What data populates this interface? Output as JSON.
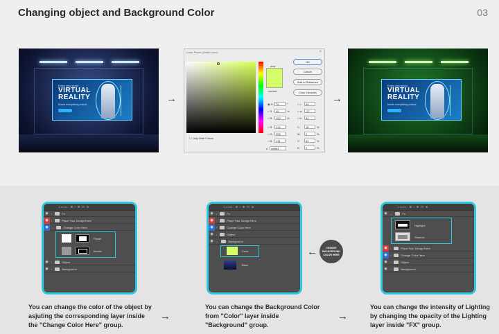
{
  "header": {
    "title": "Changing object and Background Color",
    "page_number": "03"
  },
  "scene_before": {
    "small_text": "Enjoy new world",
    "headline_1": "VIRTUAL",
    "headline_2": "REALITY",
    "subtext": "Made everything virtual",
    "button": "Connect with Us",
    "tone": "blue"
  },
  "scene_after": {
    "small_text": "Enjoy new world",
    "headline_1": "VIRTUAL",
    "headline_2": "REALITY",
    "subtext": "Made everything virtual",
    "button": "Connect with Us",
    "tone": "green"
  },
  "color_picker": {
    "title": "Color Picker (Solid Color)",
    "new_label": "new",
    "current_label": "current",
    "buttons": {
      "ok": "OK",
      "cancel": "Cancel",
      "add": "Add to Swatches",
      "libraries": "Color Libraries"
    },
    "fields": {
      "H": "79",
      "S": "49",
      "B": "100",
      "R": "216",
      "G": "255",
      "B2": "131",
      "L": "95",
      "a": "-27",
      "b": "54",
      "C": "18",
      "M": "0",
      "Y": "62",
      "K": "0"
    },
    "units": {
      "deg": "°",
      "pct": "%"
    },
    "only_web": "Only Web Colors",
    "hex_label": "#",
    "hex": "d8ff83",
    "selected_color": "#d3ff66"
  },
  "panel1": {
    "toolbar": "Lock: ⊞ ∕ ✥ ⊡ ⊕",
    "layers": [
      "Fx",
      "Place Your Design Here",
      "Change Color Here",
      "Poster",
      "Border",
      "Object",
      "Background"
    ]
  },
  "panel2": {
    "toolbar": "Lock: ⊞ ∕ ✥ ⊡ ⊕",
    "layers": [
      "Fx",
      "Place Your Design Here",
      "Change Color Here",
      "Object",
      "Background",
      "Color",
      "Base"
    ]
  },
  "panel3": {
    "toolbar": "Lock: ⊞ ∕ ✥ ⊡ ⊕",
    "layers": [
      "Fx",
      "Highlight",
      "Shadow",
      "Place Your Design Here",
      "Change Color Here",
      "Object",
      "Background"
    ]
  },
  "callout": {
    "text": "CHANGE BACKGROUND COLOR HERE"
  },
  "captions": {
    "c1": "You can change the color of the object by asjuting the corresponding layer inside the \"Change Color Here\" group.",
    "c2": "You  can change the Background Color from \"Color\" layer inside \"Background\" group.",
    "c3": "You can change the intensity of Lighting by changing the opacity of the Lighting layer inside \"FX\" group."
  },
  "arrows": {
    "right": "→",
    "left": "←"
  },
  "colors": {
    "accent": "#2cc8e2",
    "red_eye": "#d33c3c",
    "blue_eye": "#2d6fd1"
  }
}
